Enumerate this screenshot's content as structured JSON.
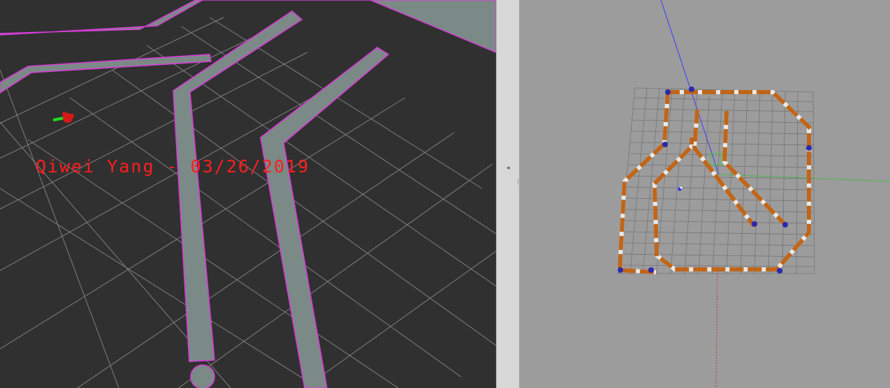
{
  "rviz": {
    "overlay_text": "Qiwei Yang - 03/26/2019",
    "colors": {
      "background": "#303030",
      "grid": "#9a9a9a",
      "obstacle": "#7b8a86",
      "obstacle_edge": "#d83cd8",
      "overlay_text": "#ff1e1e",
      "robot": "#d81818",
      "robot_axis": "#22dd22"
    },
    "icons": [
      "robot-marker-icon"
    ]
  },
  "splitter": {
    "grip_glyph": "◂",
    "handle_glyph": "⋮"
  },
  "gazebo": {
    "colors": {
      "background": "#9c9c9c",
      "grid": "#6c6c6c",
      "wall_orange": "#c0661a",
      "wall_white": "#e8e8e8",
      "post": "#2a2ab0",
      "axis_x": "#3a3aff",
      "axis_y": "#38c038",
      "axis_z": "#d03030"
    }
  }
}
